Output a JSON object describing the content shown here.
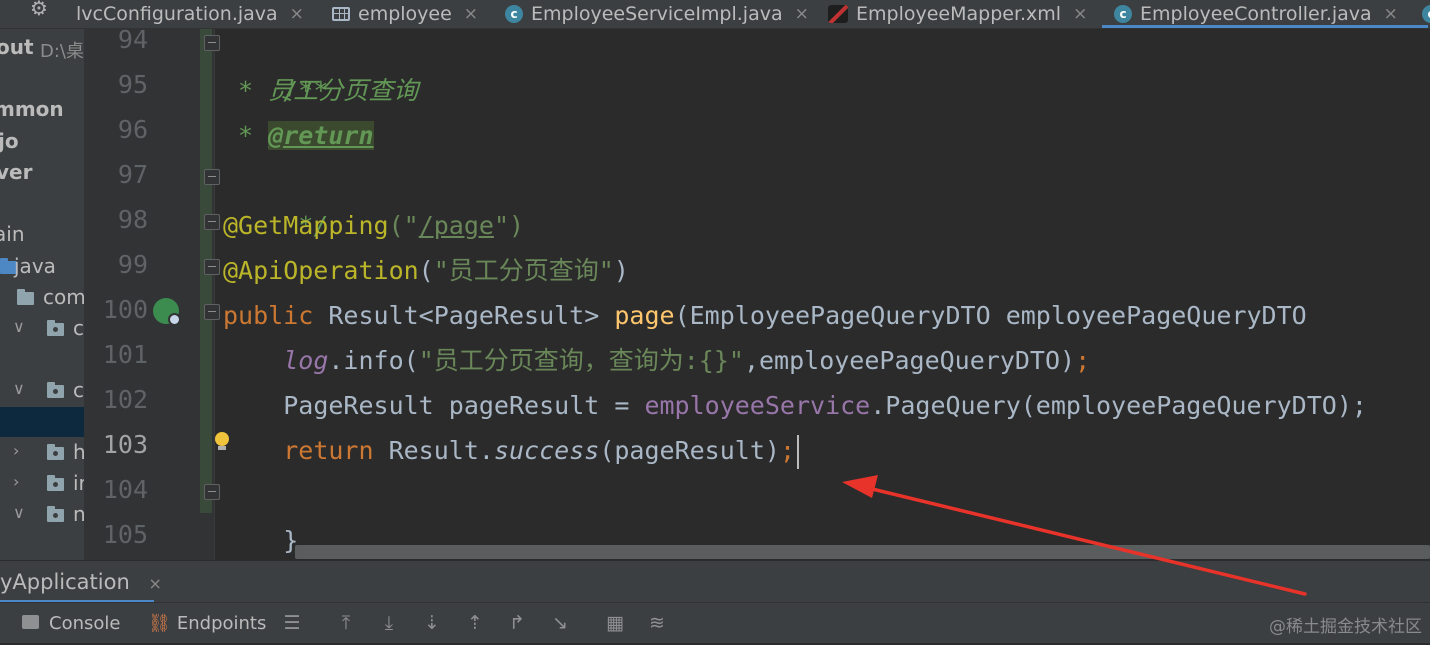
{
  "tabs": [
    {
      "label": "lvcConfiguration.java",
      "icon": "java-class-icon",
      "active": false
    },
    {
      "label": "employee",
      "icon": "table-icon",
      "active": false
    },
    {
      "label": "EmployeeServiceImpl.java",
      "icon": "java-class-icon",
      "active": false
    },
    {
      "label": "EmployeeMapper.xml",
      "icon": "mybatis-mapper-icon",
      "active": false
    },
    {
      "label": "EmployeeController.java",
      "icon": "java-class-icon",
      "active": true
    }
  ],
  "tab_close": "×",
  "project": {
    "root_label": "out",
    "root_path": "D:\\桌",
    "items": [
      "mmon",
      "jo",
      "ver",
      "ain",
      "java",
      "com",
      "c",
      "c",
      "h",
      "ir",
      "n"
    ]
  },
  "editor": {
    "line_numbers": [
      "94",
      "95",
      "96",
      "97",
      "98",
      "99",
      "100",
      "101",
      "102",
      "103",
      "104",
      "105"
    ],
    "current_line": "103",
    "code": {
      "l94": "/**",
      "l95_star": " * ",
      "l95_text": "员工分页查询",
      "l96_star": " * ",
      "l96_tag": "@return",
      "l97": " */",
      "l98_ann": "@GetMapping",
      "l98_open": "(\"",
      "l98_path": "/page",
      "l98_close": "\")",
      "l99_ann": "@ApiOperation",
      "l99_open": "(",
      "l99_str": "\"员工分页查询\"",
      "l99_close": ")",
      "l100_kw": "public",
      "l100_type": " Result<PageResult> ",
      "l100_fn": "page",
      "l100_rest": "(EmployeePageQueryDTO employeePageQueryDTO",
      "l101_indent": "    ",
      "l101_log": "log",
      "l101_mid": ".info(",
      "l101_str": "\"员工分页查询，查询为:{}\"",
      "l101_rest": ",employeePageQueryDTO)",
      "l101_semi": ";",
      "l102_indent": "    ",
      "l102_a": "PageResult pageResult = ",
      "l102_fld": "employeeService",
      "l102_rest": ".PageQuery(employeePageQueryDTO);",
      "l103_indent": "    ",
      "l103_kw": "return",
      "l103_a": " Result.",
      "l103_it": "success",
      "l103_b": "(pageResult)",
      "l103_semi": ";",
      "l104": "}"
    }
  },
  "run_panel": {
    "tab_label": "yApplication",
    "toolbar": {
      "console": "Console",
      "endpoints": "Endpoints"
    }
  },
  "watermark": "@稀土掘金技术社区",
  "colors": {
    "accent": "#4a88c7",
    "arrow": "#e8332a",
    "background": "#2b2b2b"
  }
}
